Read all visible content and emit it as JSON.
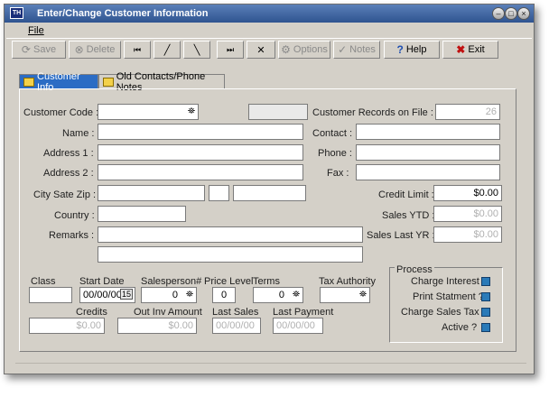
{
  "window": {
    "title": "Enter/Change Customer Information",
    "icon_text": "TH"
  },
  "menu": {
    "file": "File"
  },
  "toolbar": {
    "save": "Save",
    "delete": "Delete",
    "first": "⏮",
    "prev": "╱",
    "next": "╲",
    "last": "⏭",
    "cancel": "✕",
    "options": "Options",
    "notes": "Notes",
    "help": "Help",
    "exit": "Exit"
  },
  "tabs": {
    "customer_info": "Customer Info",
    "old_contacts": "Old Contacts/Phone Notes"
  },
  "form": {
    "customer_code_label": "Customer Code :",
    "records_on_file_label": "Customer Records on File :",
    "records_on_file_value": "26",
    "name_label": "Name :",
    "contact_label": "Contact :",
    "address1_label": "Address 1 :",
    "phone_label": "Phone :",
    "address2_label": "Address 2 :",
    "fax_label": "Fax :",
    "city_state_zip_label": "City Sate Zip :",
    "credit_limit_label": "Credit Limit :",
    "credit_limit_value": "$0.00",
    "country_label": "Country :",
    "sales_ytd_label": "Sales YTD :",
    "sales_ytd_value": "$0.00",
    "remarks_label": "Remarks :",
    "sales_last_yr_label": "Sales Last YR :",
    "sales_last_yr_value": "$0.00",
    "class_label": "Class",
    "start_date_label": "Start Date",
    "start_date_value": "00/00/00",
    "salesperson_label": "Salesperson#",
    "salesperson_value": "0",
    "price_level_label": "Price Level",
    "price_level_value": "0",
    "terms_label": "Terms",
    "terms_value": "0",
    "tax_authority_label": "Tax Authority",
    "credits_label": "Credits",
    "credits_value": "$0.00",
    "out_inv_label": "Out Inv Amount",
    "out_inv_value": "$0.00",
    "last_sales_label": "Last Sales",
    "last_sales_value": "00/00/00",
    "last_payment_label": "Last Payment",
    "last_payment_value": "00/00/00"
  },
  "process": {
    "title": "Process",
    "charge_interest": "Charge Interest ?",
    "print_statement": "Print Statment ?",
    "charge_sales_tax": "Charge Sales Tax ?",
    "active": "Active ?"
  }
}
